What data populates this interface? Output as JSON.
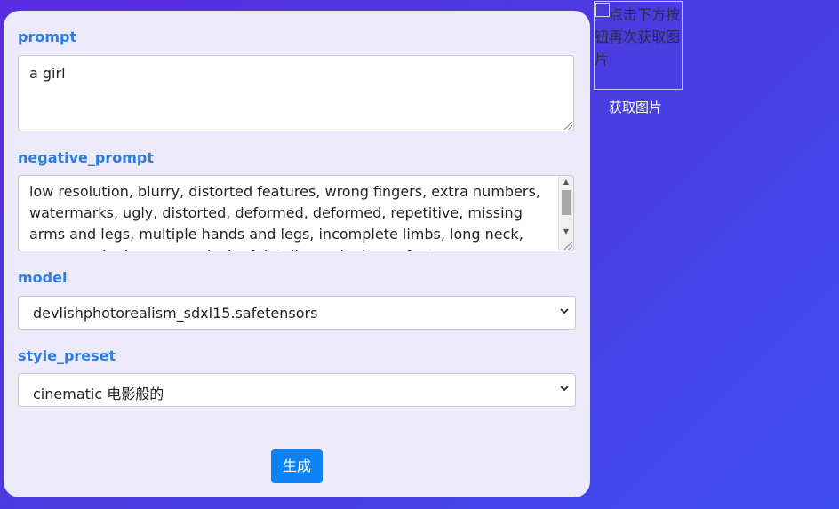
{
  "form": {
    "prompt": {
      "label": "prompt",
      "value": "a girl"
    },
    "negative_prompt": {
      "label": "negative_prompt",
      "value": "low resolution, blurry, distorted features, wrong fingers, extra numbers, watermarks, ugly, distorted, deformed, deformed, repetitive, missing arms and legs, multiple hands and legs, incomplete limbs, long neck, cross-eyed, glassy eyes, lack of detail, poorly drawn features"
    },
    "model": {
      "label": "model",
      "selected": "devlishphotorealism_sdxl15.safetensors"
    },
    "style_preset": {
      "label": "style_preset",
      "selected": "cinematic 电影般的"
    },
    "submit_label": "生成"
  },
  "image_panel": {
    "alt_text": "点击下方按钮再次获取图片",
    "fetch_label": "获取图片"
  },
  "colors": {
    "accent": "#2a7de1",
    "button": "#0d83f7",
    "panel": "#ece9f8",
    "bg_start": "#5a2be0",
    "bg_end": "#3f4df0"
  },
  "icons": [
    "broken-image-icon",
    "chevron-down-icon",
    "resize-grip-icon",
    "scroll-up-icon",
    "scroll-down-icon"
  ]
}
